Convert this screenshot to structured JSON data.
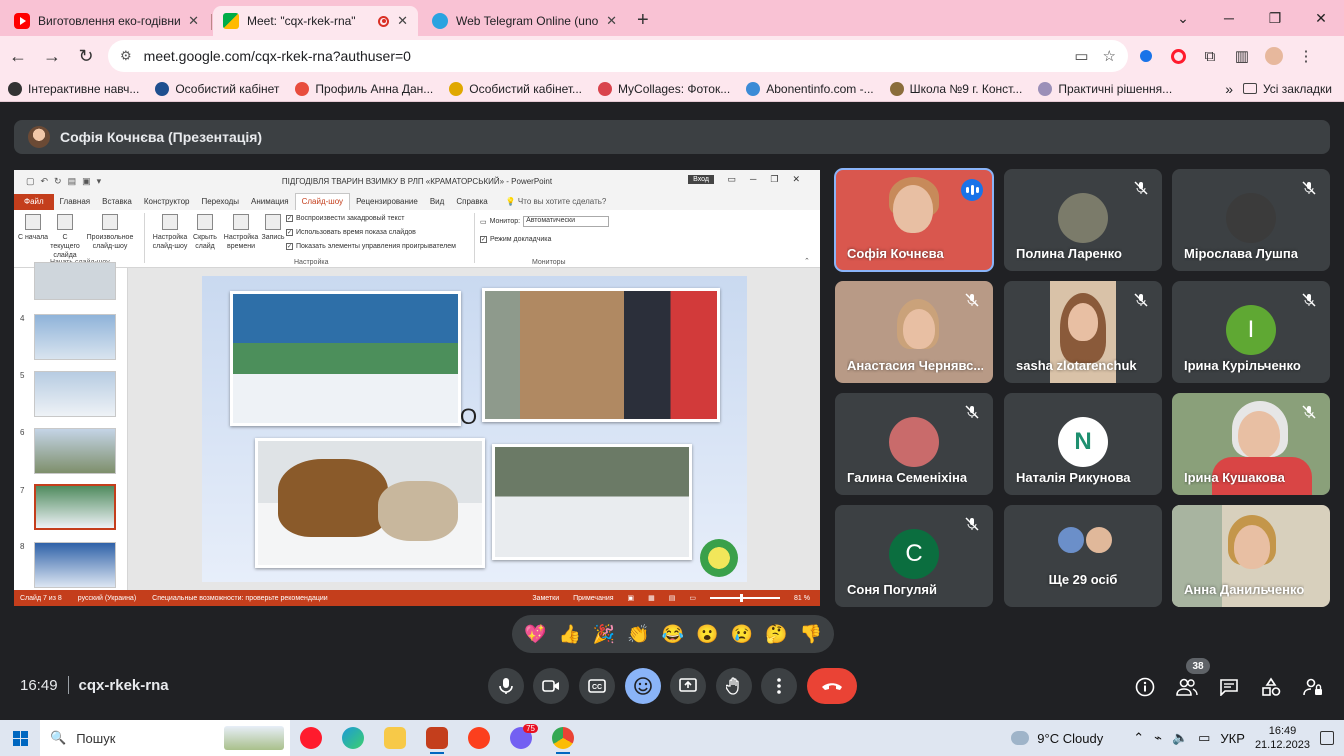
{
  "browser": {
    "tabs": [
      {
        "title": "Виготовлення еко-годівничк",
        "icon": "youtube-icon"
      },
      {
        "title": "Meet: \"cqx-rkek-rna\"",
        "icon": "meet-icon"
      },
      {
        "title": "Web Telegram Online (unoffici",
        "icon": "telegram-icon"
      }
    ],
    "url": "meet.google.com/cqx-rkek-rna?authuser=0",
    "bookmarks": [
      "Інтерактивне навч...",
      "Особистий кабінет",
      "Профиль Анна Дан...",
      "Особистий кабінет...",
      "MyCollages: Фоток...",
      "Abonentinfo.com -...",
      "Школа №9 г. Конст...",
      "Практичні рішення..."
    ],
    "all_bookmarks": "Усі закладки",
    "more_glyph": "»"
  },
  "meet": {
    "presenter_label": "Софія Кочнєва (Презентація)",
    "time": "16:49",
    "meeting_code": "cqx-rkek-rna",
    "participant_count": "38",
    "participants": [
      {
        "name": "Софія Кочнєва",
        "speaking": true
      },
      {
        "name": "Полина Ларенко"
      },
      {
        "name": "Міроcлава Лушпа"
      },
      {
        "name": "Анастасия Чернявс..."
      },
      {
        "name": "sasha zlotarenchuk"
      },
      {
        "name": "Ірина Курільченко",
        "initial": "І",
        "color": "#5fa833"
      },
      {
        "name": "Галина Семеніхіна"
      },
      {
        "name": "Наталія Рикунова",
        "initial": "N",
        "color": "#ffffff"
      },
      {
        "name": "Ірина Кушакова"
      },
      {
        "name": "Соня Погуляй",
        "initial": "С",
        "color": "#0b6e3f"
      },
      {
        "name": "Ще 29 осіб"
      },
      {
        "name": "Анна Данильченко"
      }
    ],
    "reactions": [
      "💖",
      "👍",
      "🎉",
      "👏",
      "😂",
      "😮",
      "😢",
      "🤔",
      "👎"
    ]
  },
  "powerpoint": {
    "window_title": "ПІДГОДІВЛЯ ТВАРИН ВЗИМКУ В РЛП «КРАМАТОРСЬКИЙ»  -  PowerPoint",
    "sign_in": "Вход",
    "ribbon_tabs": [
      "Файл",
      "Главная",
      "Вставка",
      "Конструктор",
      "Переходы",
      "Анимация",
      "Слайд-шоу",
      "Рецензирование",
      "Вид",
      "Справка"
    ],
    "active_tab": "Слайд-шоу",
    "tell_me": "Что вы хотите сделать?",
    "buttons": [
      {
        "label": "С начала"
      },
      {
        "label": "С текущего слайда"
      },
      {
        "label": "Произвольное слайд-шоу"
      },
      {
        "label": "Настройка слайд-шоу"
      },
      {
        "label": "Скрыть слайд"
      },
      {
        "label": "Настройка времени"
      },
      {
        "label": "Запись"
      }
    ],
    "group_start": "Начать слайд-шоу",
    "group_setup": "Настройка",
    "group_monitors": "Мониторы",
    "checkboxes": [
      "Воспроизвести закадровый текст",
      "Использовать время показа слайдов",
      "Показать элементы управления проигрывателем"
    ],
    "monitor_label": "Монитор:",
    "monitor_value": "Автоматически",
    "presenter_view": "Режим докладчика",
    "slide_numbers": [
      "4",
      "5",
      "6",
      "7",
      "8"
    ],
    "slide_text": "О",
    "status": {
      "slide": "Слайд 7 из 8",
      "language": "русский (Украина)",
      "accessibility": "Специальные возможности: проверьте рекомендации",
      "notes": "Заметки",
      "comments": "Примечания",
      "zoom": "81 %"
    }
  },
  "taskbar": {
    "search_label": "Пошук",
    "weather": "9°C  Cloudy",
    "language": "УКР",
    "time": "16:49",
    "date": "21.12.2023",
    "apps": [
      {
        "icon": "opera-icon",
        "color": "#ff1b2d"
      },
      {
        "icon": "edge-icon",
        "color": "#1d9ad8"
      },
      {
        "icon": "file-explorer-icon",
        "color": "#f7c948"
      },
      {
        "icon": "powerpoint-icon",
        "color": "#c43e1c"
      },
      {
        "icon": "yandex-icon",
        "color": "#fc3f1d"
      },
      {
        "icon": "viber-icon",
        "color": "#7360f2"
      },
      {
        "icon": "chrome-icon",
        "color": "#34a853"
      }
    ],
    "viber_badge": "75"
  }
}
